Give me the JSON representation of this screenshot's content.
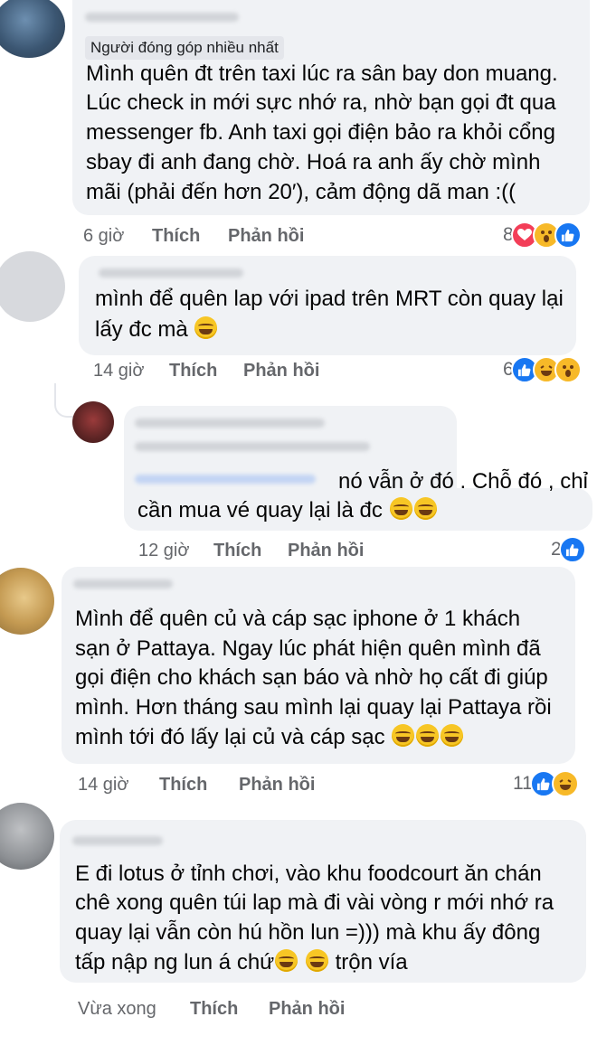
{
  "comments": [
    {
      "badge": "Người đóng góp nhiều nhất",
      "lines": [
        "Mình quên đt trên taxi lúc ra sân bay don muang.",
        "Lúc check in mới sực nhớ ra, nhờ bạn gọi đt qua",
        "messenger fb. Anh taxi gọi điện bảo ra khỏi cổng",
        "sbay đi anh đang chờ. Hoá ra anh ấy chờ mình",
        "mãi (phải đến hơn 20′), cảm động dã man :(("
      ],
      "time": "6 giờ",
      "like": "Thích",
      "reply": "Phản hồi",
      "reaction_count": "8",
      "reactions": [
        "love-icon",
        "wow-icon",
        "like-icon"
      ]
    },
    {
      "lines": [
        "mình để quên lap với ipad trên MRT còn quay lại",
        "lấy đc mà"
      ],
      "time": "14 giờ",
      "like": "Thích",
      "reply": "Phản hồi",
      "reaction_count": "6",
      "reactions": [
        "like-icon",
        "haha-icon",
        "wow-icon"
      ]
    },
    {
      "lines": [
        "nó vẫn ở đó . Chỗ đó , chỉ",
        "cần mua vé quay lại là đc"
      ],
      "time": "12 giờ",
      "like": "Thích",
      "reply": "Phản hồi",
      "reaction_count": "2",
      "reactions": [
        "like-icon"
      ]
    },
    {
      "lines": [
        "Mình để quên củ và cáp sạc iphone ở 1 khách",
        "sạn ở Pattaya. Ngay lúc phát hiện quên mình đã",
        "gọi điện cho khách sạn báo và nhờ họ cất đi giúp",
        "mình. Hơn tháng sau mình lại quay lại Pattaya rồi",
        "mình tới đó lấy lại củ và cáp sạc"
      ],
      "time": "14 giờ",
      "like": "Thích",
      "reply": "Phản hồi",
      "reaction_count": "11",
      "reactions": [
        "like-icon",
        "haha-icon"
      ]
    },
    {
      "lines": [
        "E đi lotus ở tỉnh chơi, vào khu foodcourt ăn chán",
        "chê xong quên túi lap mà đi vài vòng r mới nhớ ra",
        "quay lại vẫn còn hú hồn lun =))) mà khu ấy đông",
        "tấp nập ng lun á chứ",
        "trộn vía"
      ],
      "time": "Vừa xong",
      "like": "Thích",
      "reply": "Phản hồi"
    }
  ],
  "colors": {
    "like": "#1877f2",
    "love": "#f33e58",
    "wow": "#f7b928",
    "bubble": "#f0f2f5",
    "meta": "#65676b"
  }
}
